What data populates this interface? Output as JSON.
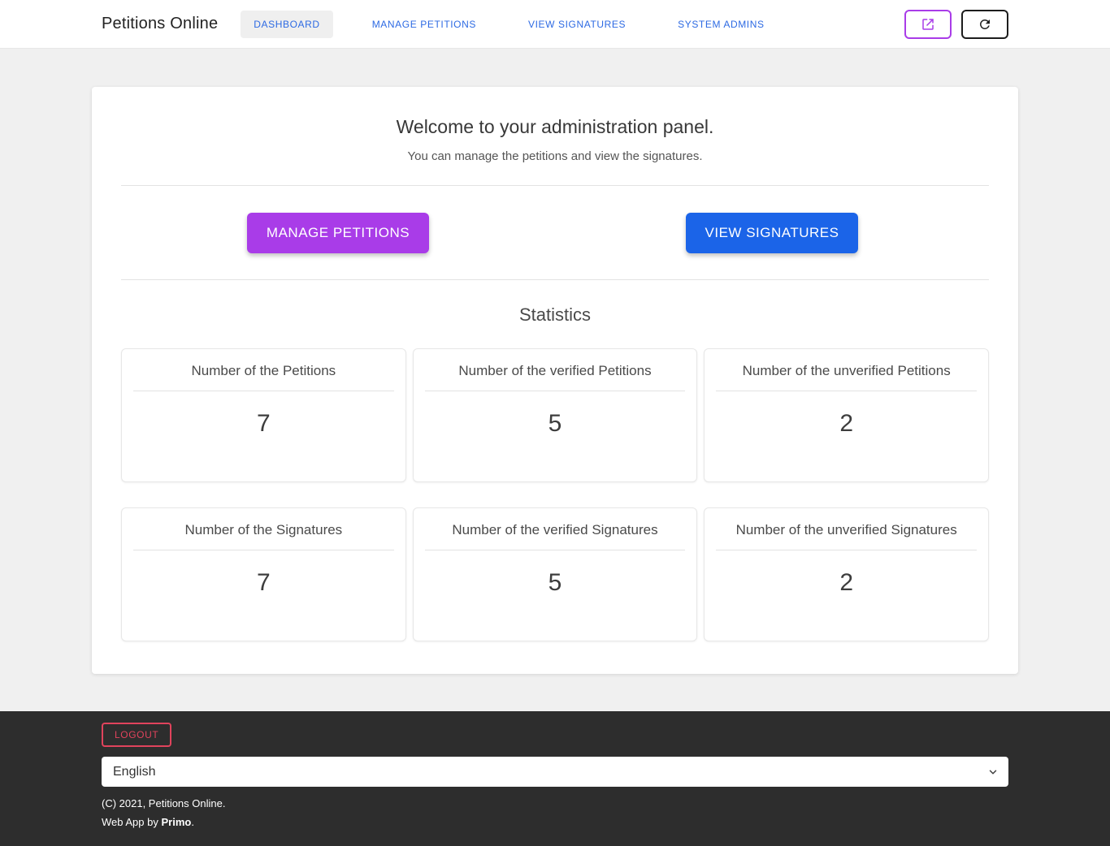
{
  "colors": {
    "accent_purple": "#a93ce8",
    "accent_blue": "#1b64e8",
    "nav_link_blue": "#2d6ae3",
    "logout_red": "#e0435c",
    "footer_bg": "#2d2d2d",
    "page_bg": "#f0f0f0"
  },
  "navbar": {
    "brand": "Petitions Online",
    "items": [
      {
        "label": "DASHBOARD",
        "active": true
      },
      {
        "label": "MANAGE PETITIONS",
        "active": false
      },
      {
        "label": "VIEW SIGNATURES",
        "active": false
      },
      {
        "label": "SYSTEM ADMINS",
        "active": false
      }
    ],
    "icon_buttons": [
      {
        "name": "external-link-icon"
      },
      {
        "name": "refresh-icon"
      }
    ]
  },
  "main": {
    "welcome_title": "Welcome to your administration panel.",
    "welcome_subtitle": "You can manage the petitions and view the signatures.",
    "actions": {
      "manage_label": "MANAGE PETITIONS",
      "view_label": "VIEW SIGNATURES"
    },
    "statistics": {
      "heading": "Statistics",
      "cards": [
        {
          "label": "Number of the Petitions",
          "value": "7"
        },
        {
          "label": "Number of the verified Petitions",
          "value": "5"
        },
        {
          "label": "Number of the unverified Petitions",
          "value": "2"
        },
        {
          "label": "Number of the Signatures",
          "value": "7"
        },
        {
          "label": "Number of the verified Signatures",
          "value": "5"
        },
        {
          "label": "Number of the unverified Signatures",
          "value": "2"
        }
      ]
    }
  },
  "footer": {
    "logout_label": "LOGOUT",
    "language_select": {
      "value": "English"
    },
    "copyright": "(C) 2021, Petitions Online.",
    "credit_prefix": "Web App by ",
    "credit_name": "Primo",
    "credit_suffix": "."
  }
}
